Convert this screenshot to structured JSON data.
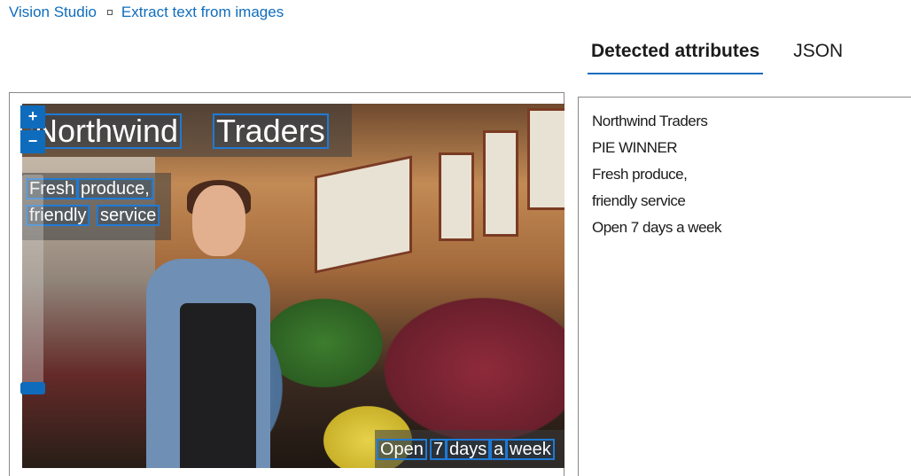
{
  "breadcrumb": {
    "root": "Vision Studio",
    "current": "Extract text from images"
  },
  "tabs": [
    {
      "label": "Detected attributes",
      "active": true
    },
    {
      "label": "JSON",
      "active": false
    }
  ],
  "image_viewer": {
    "zoom_in_label": "+",
    "zoom_out_label": "−",
    "ocr_overlay": {
      "line1": [
        "Northwind",
        "Traders"
      ],
      "line2": [
        "Fresh",
        "produce,"
      ],
      "line3": [
        "friendly",
        "service"
      ],
      "line4": [
        "Open",
        "7",
        "days",
        "a",
        "week"
      ]
    },
    "overlay_color": "#1e7ad6"
  },
  "detected_attributes": [
    "Northwind Traders",
    "PIE WINNER",
    "Fresh produce,",
    "friendly service",
    "Open 7 days a week"
  ],
  "colors": {
    "accent": "#0f6cbd",
    "link": "#0f6cbd"
  }
}
